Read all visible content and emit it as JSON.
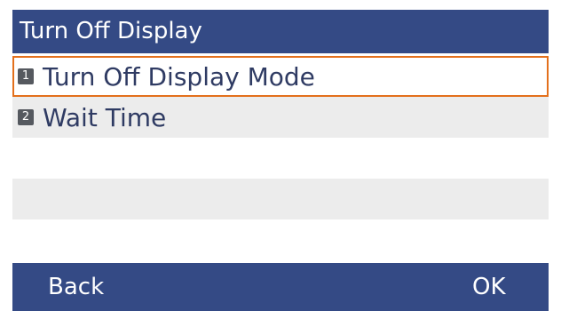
{
  "title": "Turn Off Display",
  "menu": {
    "items": [
      {
        "number": "1",
        "label": "Turn Off Display Mode",
        "selected": true
      },
      {
        "number": "2",
        "label": "Wait Time",
        "selected": false
      }
    ]
  },
  "softkeys": {
    "left": "Back",
    "right": "OK"
  },
  "colors": {
    "bar": "#344a85",
    "selection_border": "#e3701c",
    "text": "#2f3b63"
  }
}
